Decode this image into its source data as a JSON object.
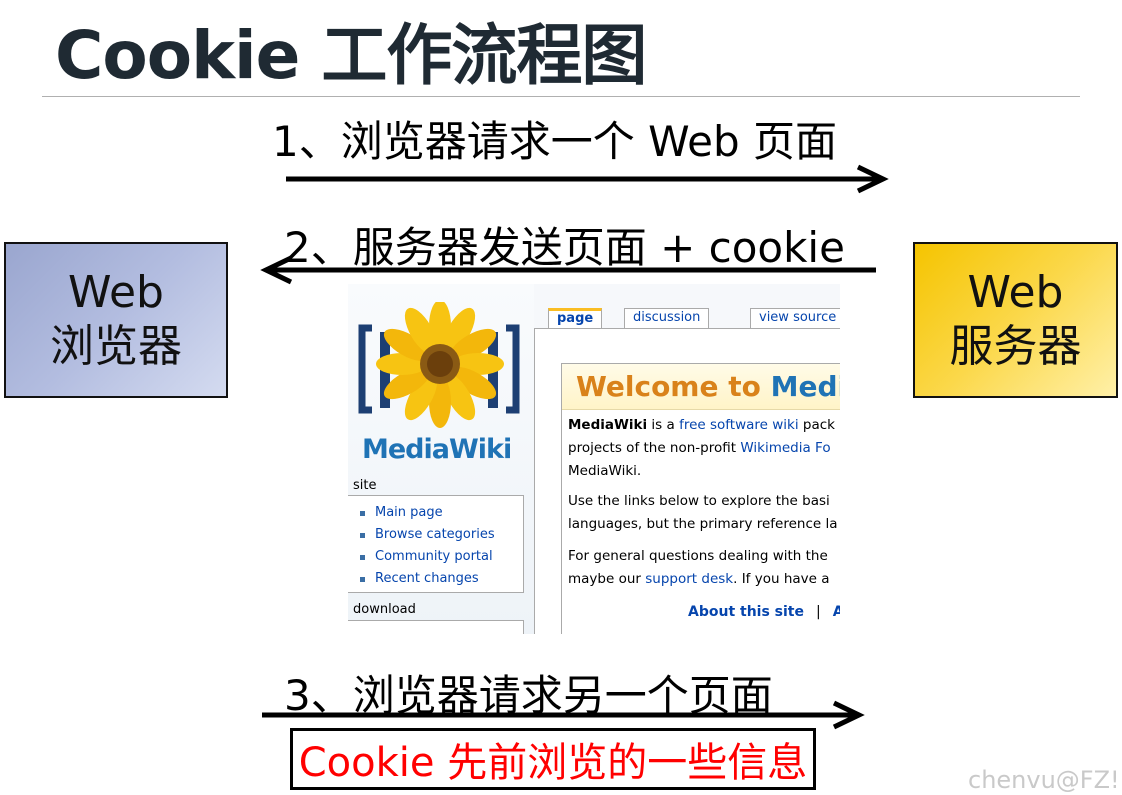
{
  "title": "Cookie 工作流程图",
  "steps": {
    "step1": "1、浏览器请求一个 Web 页面",
    "step2": "2、服务器发送页面 + cookie",
    "step3": "3、浏览器请求另一个页面"
  },
  "nodes": {
    "browser": {
      "line1": "Web",
      "line2": "浏览器"
    },
    "server": {
      "line1": "Web",
      "line2": "服务器"
    }
  },
  "note": "Cookie 先前浏览的一些信息",
  "watermark": "chenvu@FZ!",
  "mediawiki": {
    "brand": "MediaWiki",
    "tabs": [
      "page",
      "discussion",
      "view source"
    ],
    "sidebar": {
      "site_heading": "site",
      "site_items": [
        "Main page",
        "Browse categories",
        "Community portal",
        "Recent changes"
      ],
      "download_heading": "download"
    },
    "welcome": {
      "part1": "Welcome to ",
      "part2": "MediaW"
    },
    "paragraphs": {
      "p1_bold": "MediaWiki",
      "p1_a": " is a ",
      "p1_link1": "free software wiki",
      "p1_b": " pack",
      "p1_line2_a": "projects of the non-profit ",
      "p1_link2": "Wikimedia Fo",
      "p1_line3": "MediaWiki.",
      "p2_line1": "Use the links below to explore the basi",
      "p2_line2": "languages, but the primary reference la",
      "p3_line1": "For general questions dealing with the",
      "p3_line2_a": "maybe our ",
      "p3_link": "support desk",
      "p3_line2_b": ". If you have a"
    },
    "bottom_links": {
      "about": "About this site",
      "sep": "|",
      "next": "A"
    }
  },
  "colors": {
    "title": "#1f2a33",
    "browser_box": "#b3bde0",
    "server_box": "#fbd84a",
    "note_text": "#ff0000",
    "mediawiki_blue": "#1f73b5",
    "welcome_orange": "#d9821a"
  }
}
